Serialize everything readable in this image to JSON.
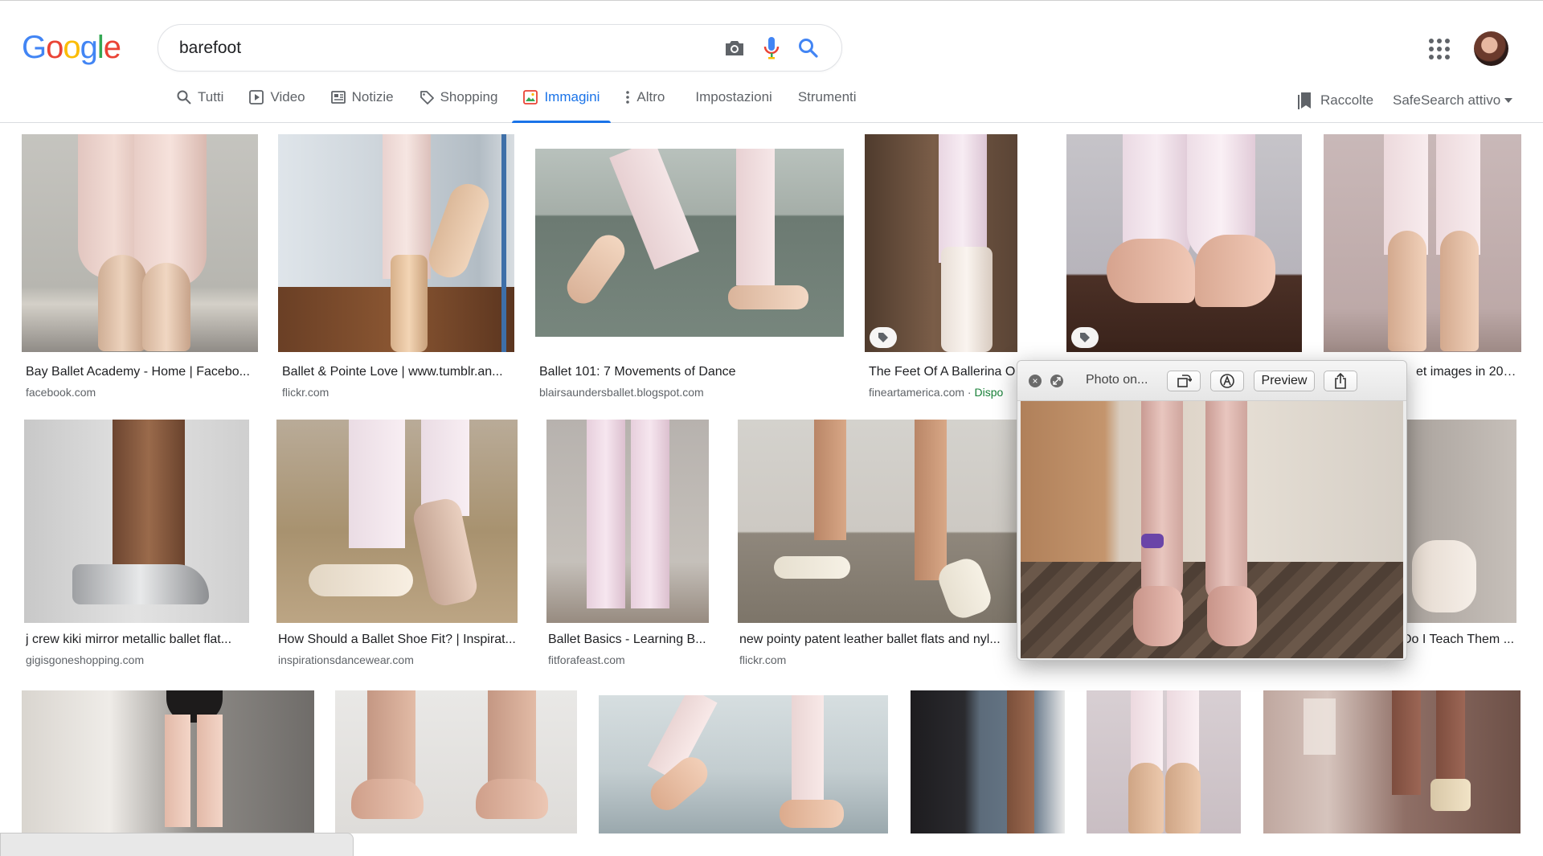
{
  "header": {
    "search_query": "barefoot",
    "logo": "Google",
    "colors": {
      "blue": "#4285F4",
      "red": "#EA4335",
      "yellow": "#FBBC05",
      "green": "#34A853",
      "accent": "#1a73e8"
    }
  },
  "tabs": [
    {
      "label": "Tutti",
      "icon": "search-icon"
    },
    {
      "label": "Video",
      "icon": "play-icon"
    },
    {
      "label": "Notizie",
      "icon": "news-icon"
    },
    {
      "label": "Shopping",
      "icon": "tag-icon"
    },
    {
      "label": "Immagini",
      "icon": "image-icon",
      "active": true
    },
    {
      "label": "Altro",
      "icon": "more-vert-icon"
    }
  ],
  "tools": {
    "settings": "Impostazioni",
    "tools": "Strumenti"
  },
  "right_links": {
    "collections": "Raccolte",
    "safesearch": "SafeSearch attivo"
  },
  "results": [
    {
      "caption": "Bay Ballet Academy - Home | Facebo...",
      "source": "facebook.com"
    },
    {
      "caption": "Ballet & Pointe Love | www.tumblr.an...",
      "source": "flickr.com"
    },
    {
      "caption": "Ballet 101: 7 Movements of Dance",
      "source": "blairsaundersballet.blogspot.com"
    },
    {
      "caption": "The Feet Of A Ballerina O",
      "source": "fineartamerica.com",
      "availability": "Dispo"
    },
    {
      "caption": "",
      "source": ""
    },
    {
      "caption": "et images in 202...",
      "source": ""
    },
    {
      "caption": "j crew kiki mirror metallic ballet flat...",
      "source": "gigisgoneshopping.com"
    },
    {
      "caption": "How Should a Ballet Shoe Fit? | Inspirat...",
      "source": "inspirationsdancewear.com"
    },
    {
      "caption": "Ballet Basics - Learning B...",
      "source": "fitforafeast.com"
    },
    {
      "caption": "new pointy patent leather ballet flats and nyl...",
      "source": "flickr.com"
    },
    {
      "caption": "Do I Teach Them ...",
      "source": ""
    }
  ],
  "preview": {
    "title": "Photo on...",
    "preview_label": "Preview"
  }
}
